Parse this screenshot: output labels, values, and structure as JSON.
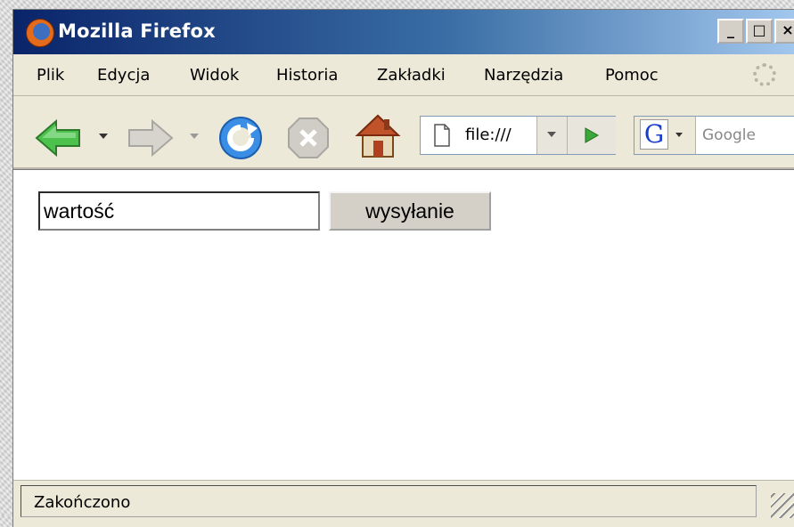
{
  "window": {
    "title": "Mozilla Firefox",
    "controls": {
      "minimize": "_",
      "maximize": "□",
      "close": "×"
    }
  },
  "menu": {
    "items": [
      {
        "label": "Plik"
      },
      {
        "label": "Edycja"
      },
      {
        "label": "Widok"
      },
      {
        "label": "Historia"
      },
      {
        "label": "Zakładki"
      },
      {
        "label": "Narzędzia"
      },
      {
        "label": "Pomoc"
      }
    ]
  },
  "toolbar": {
    "icons": [
      "back-arrow-icon",
      "forward-arrow-icon",
      "reload-icon",
      "stop-icon",
      "home-icon"
    ],
    "url": "file:///",
    "search": {
      "engine_letter": "G",
      "placeholder": "Google"
    }
  },
  "page": {
    "input_value": "wartość",
    "submit_label": "wysyłanie"
  },
  "status": {
    "text": "Zakończono"
  },
  "colors": {
    "titlebar_start": "#0a246a",
    "titlebar_end": "#a6caf0",
    "chrome": "#ece9d8",
    "back_arrow": "#4cc14c",
    "reload": "#3a8ee6"
  }
}
